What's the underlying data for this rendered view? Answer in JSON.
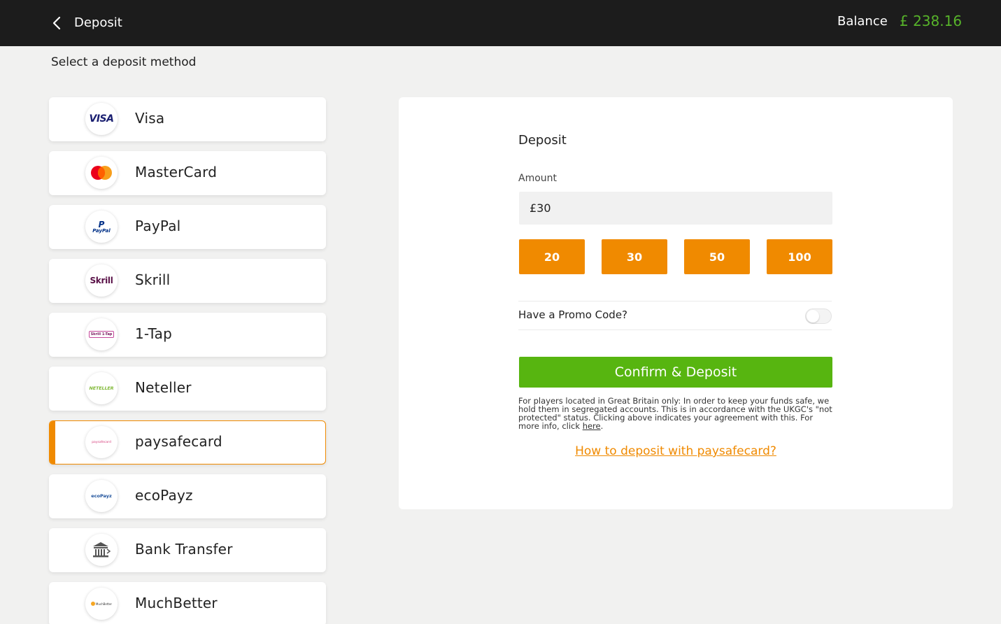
{
  "header": {
    "title": "Deposit",
    "balance_label": "Balance",
    "balance_value": "£ 238.16"
  },
  "subtitle": "Select a deposit method",
  "methods": [
    {
      "label": "Visa",
      "icon": "visa-logo",
      "logo_text": "VISA"
    },
    {
      "label": "MasterCard",
      "icon": "mastercard-logo"
    },
    {
      "label": "PayPal",
      "icon": "paypal-logo",
      "logo_text": "PayPal"
    },
    {
      "label": "Skrill",
      "icon": "skrill-logo",
      "logo_text": "Skrill"
    },
    {
      "label": "1-Tap",
      "icon": "skrill-1tap-logo",
      "logo_text": "Skrill 1-Tap"
    },
    {
      "label": "Neteller",
      "icon": "neteller-logo",
      "logo_text": "NETELLER"
    },
    {
      "label": "paysafecard",
      "icon": "paysafecard-logo",
      "logo_text": "paysafecard",
      "selected": true
    },
    {
      "label": "ecoPayz",
      "icon": "ecopayz-logo",
      "logo_text": "ecoPayz"
    },
    {
      "label": "Bank Transfer",
      "icon": "bank-icon"
    },
    {
      "label": "MuchBetter",
      "icon": "muchbetter-logo",
      "logo_text": "MuchBetter"
    }
  ],
  "panel": {
    "title": "Deposit",
    "amount_label": "Amount",
    "amount_value": "£30",
    "quick_amounts": [
      "20",
      "30",
      "50",
      "100"
    ],
    "promo_label": "Have a Promo Code?",
    "promo_enabled": false,
    "confirm_label": "Confirm & Deposit",
    "disclaimer_text": "For players located in Great Britain only: In order to keep your funds safe, we hold them in segregated accounts. This is in accordance with the UKGC's \"not protected\" status. Clicking above indicates your agreement with this. For more info, click ",
    "disclaimer_link": "here",
    "disclaimer_end": ".",
    "howto_link": "How to deposit with paysafecard?"
  },
  "colors": {
    "accent": "#f08a00",
    "confirm": "#57b510",
    "balance": "#57b32a",
    "topbar": "#1c1c1c"
  }
}
